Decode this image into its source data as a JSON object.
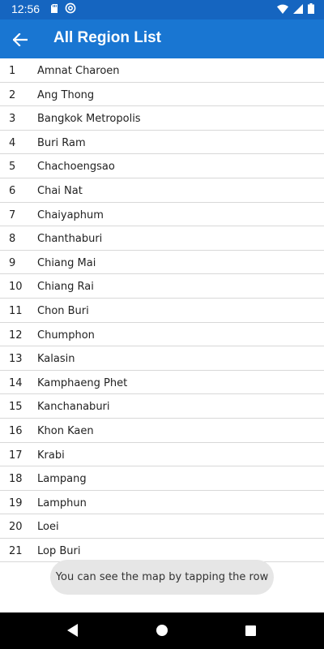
{
  "status_bar": {
    "time": "12:56",
    "icons": [
      "sd-card-icon",
      "at-icon",
      "wifi-icon",
      "signal-icon",
      "battery-icon"
    ]
  },
  "app_bar": {
    "back_icon": "arrow-left-icon",
    "title": "All Region List",
    "color": "#1976d2"
  },
  "regions": [
    {
      "num": "1",
      "name": "Amnat Charoen"
    },
    {
      "num": "2",
      "name": "Ang Thong"
    },
    {
      "num": "3",
      "name": "Bangkok Metropolis"
    },
    {
      "num": "4",
      "name": "Buri Ram"
    },
    {
      "num": "5",
      "name": "Chachoengsao"
    },
    {
      "num": "6",
      "name": "Chai Nat"
    },
    {
      "num": "7",
      "name": "Chaiyaphum"
    },
    {
      "num": "8",
      "name": "Chanthaburi"
    },
    {
      "num": "9",
      "name": "Chiang Mai"
    },
    {
      "num": "10",
      "name": "Chiang Rai"
    },
    {
      "num": "11",
      "name": "Chon Buri"
    },
    {
      "num": "12",
      "name": "Chumphon"
    },
    {
      "num": "13",
      "name": "Kalasin"
    },
    {
      "num": "14",
      "name": "Kamphaeng Phet"
    },
    {
      "num": "15",
      "name": "Kanchanaburi"
    },
    {
      "num": "16",
      "name": "Khon Kaen"
    },
    {
      "num": "17",
      "name": "Krabi"
    },
    {
      "num": "18",
      "name": "Lampang"
    },
    {
      "num": "19",
      "name": "Lamphun"
    },
    {
      "num": "20",
      "name": "Loei"
    },
    {
      "num": "21",
      "name": "Lop Buri"
    }
  ],
  "toast": {
    "message": "You can see the map by tapping the row"
  },
  "nav_bar": {
    "buttons": [
      "back-triangle-icon",
      "home-circle-icon",
      "recents-square-icon"
    ]
  }
}
